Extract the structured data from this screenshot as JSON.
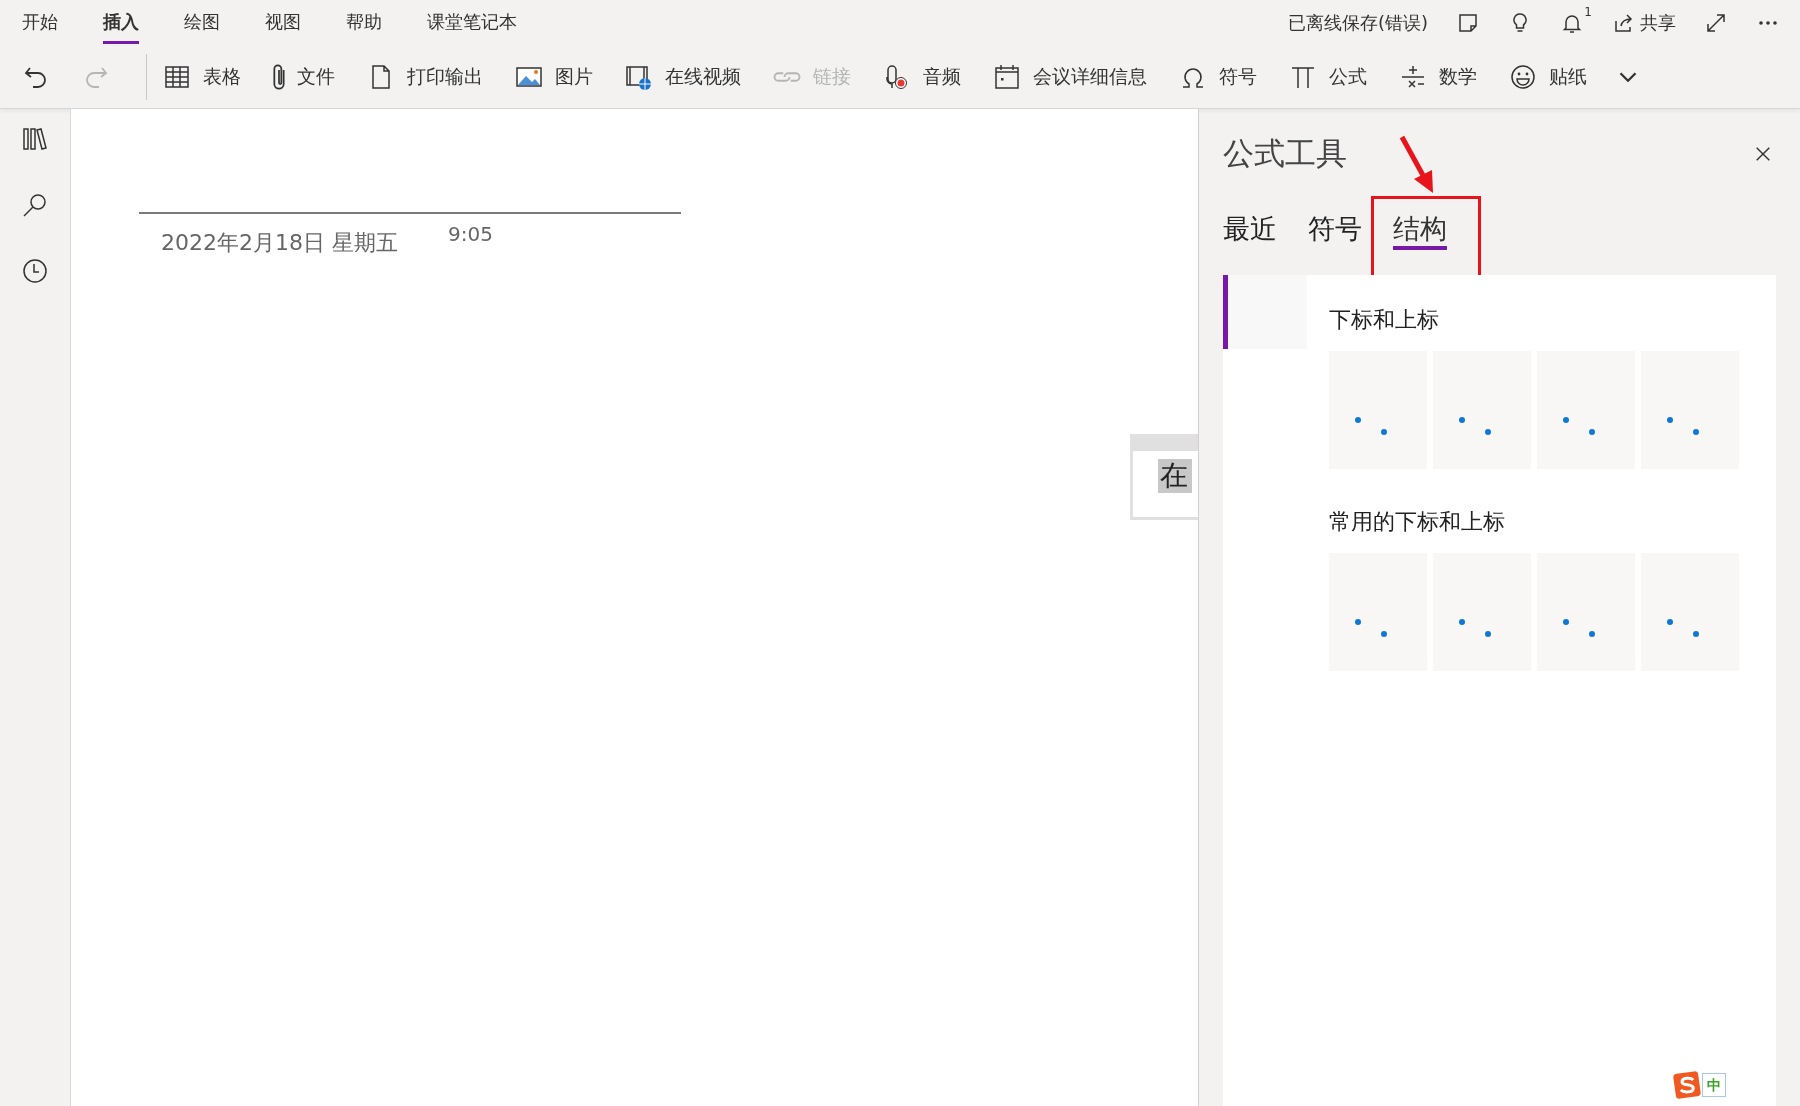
{
  "ribbon_tabs": [
    {
      "label": "开始",
      "selected": false
    },
    {
      "label": "插入",
      "selected": true
    },
    {
      "label": "绘图",
      "selected": false
    },
    {
      "label": "视图",
      "selected": false
    },
    {
      "label": "帮助",
      "selected": false
    },
    {
      "label": "课堂笔记本",
      "selected": false
    }
  ],
  "status": "已离线保存(错误)",
  "notification_count": "1",
  "share_label": "共享",
  "toolbar": [
    {
      "kind": "undo",
      "disabled": false
    },
    {
      "kind": "redo",
      "disabled": true
    },
    {
      "kind": "table",
      "label": "表格",
      "disabled": false
    },
    {
      "kind": "attach",
      "label": "文件",
      "disabled": false
    },
    {
      "kind": "page",
      "label": "打印输出",
      "disabled": false
    },
    {
      "kind": "image",
      "label": "图片",
      "disabled": false
    },
    {
      "kind": "video",
      "label": "在线视频",
      "disabled": false
    },
    {
      "kind": "link",
      "label": "链接",
      "disabled": true
    },
    {
      "kind": "audio",
      "label": "音频",
      "disabled": false
    },
    {
      "kind": "calendar",
      "label": "会议详细信息",
      "disabled": false
    },
    {
      "kind": "omega",
      "label": "符号",
      "disabled": false
    },
    {
      "kind": "pi",
      "label": "公式",
      "disabled": false
    },
    {
      "kind": "math",
      "label": "数学",
      "disabled": false
    },
    {
      "kind": "emoji",
      "label": "贴纸",
      "disabled": false
    },
    {
      "kind": "chevron",
      "disabled": false
    }
  ],
  "note": {
    "date": "2022年2月18日 星期五",
    "time": "9:05",
    "box_text": "在"
  },
  "panel": {
    "title": "公式工具",
    "tabs": [
      {
        "label": "最近",
        "selected": false
      },
      {
        "label": "符号",
        "selected": false
      },
      {
        "label": "结构",
        "selected": true
      }
    ],
    "categories": [
      {
        "selected": true
      }
    ],
    "sections": [
      {
        "title": "下标和上标",
        "tiles": [
          {
            "kind": "dots"
          },
          {
            "kind": "dots"
          },
          {
            "kind": "dots"
          },
          {
            "kind": "dots"
          }
        ]
      },
      {
        "title": "常用的下标和上标",
        "tiles": [
          {
            "kind": "dots"
          },
          {
            "kind": "dots"
          },
          {
            "kind": "dots"
          },
          {
            "kind": "dots"
          }
        ]
      }
    ]
  },
  "ime": {
    "label": "中"
  }
}
